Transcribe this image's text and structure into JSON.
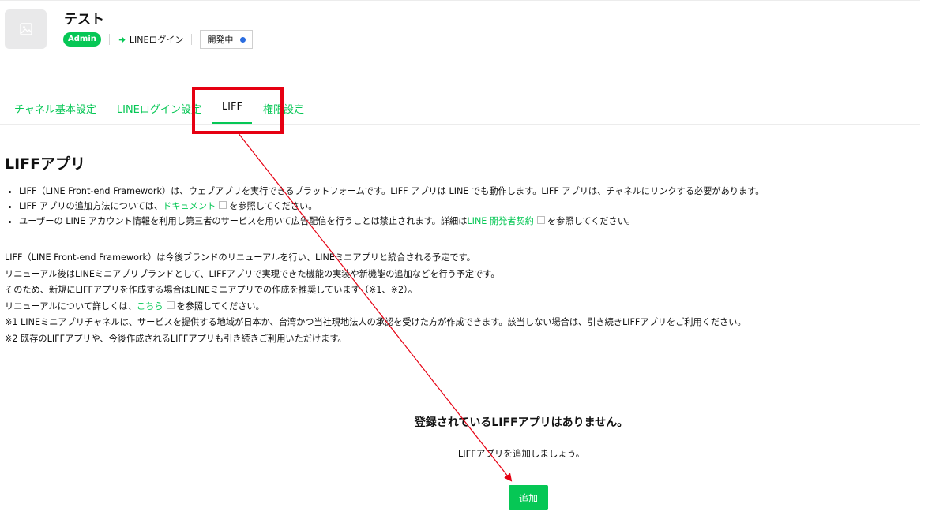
{
  "channel": {
    "name": "テスト",
    "role_badge": "Admin",
    "type_label": "LINEログイン",
    "status_label": "開発中"
  },
  "tabs": [
    {
      "label": "チャネル基本設定"
    },
    {
      "label": "LINEログイン設定"
    },
    {
      "label": "LIFF"
    },
    {
      "label": "権限設定"
    }
  ],
  "section": {
    "title": "LIFFアプリ",
    "bullet1": "LIFF（LINE Front-end Framework）は、ウェブアプリを実行できるプラットフォームです。LIFF アプリは LINE でも動作します。LIFF アプリは、チャネルにリンクする必要があります。",
    "bullet2_prefix": "LIFF アプリの追加方法については、",
    "bullet2_link": "ドキュメント",
    "bullet2_suffix": "を参照してください。",
    "bullet3_prefix": "ユーザーの LINE アカウント情報を利用し第三者のサービスを用いて広告配信を行うことは禁止されます。詳細は",
    "bullet3_link": "LINE 開発者契約",
    "bullet3_suffix": "を参照してください。"
  },
  "notice": {
    "line1": "LIFF（LINE Front-end Framework）は今後ブランドのリニューアルを行い、LINEミニアプリと統合される予定です。",
    "line2": "リニューアル後はLINEミニアプリブランドとして、LIFFアプリで実現できた機能の実装や新機能の追加などを行う予定です。",
    "line3": "そのため、新規にLIFFアプリを作成する場合はLINEミニアプリでの作成を推奨しています（※1、※2）。",
    "line4_prefix": "リニューアルについて詳しくは、",
    "line4_link": "こちら",
    "line4_suffix": "を参照してください。",
    "note1": "※1 LINEミニアプリチャネルは、サービスを提供する地域が日本か、台湾かつ当社現地法人の承認を受けた方が作成できます。該当しない場合は、引き続きLIFFアプリをご利用ください。",
    "note2": "※2 既存のLIFFアプリや、今後作成されるLIFFアプリも引き続きご利用いただけます。"
  },
  "empty_state": {
    "title": "登録されているLIFFアプリはありません。",
    "subtitle": "LIFFアプリを追加しましょう。",
    "button_label": "追加"
  },
  "colors": {
    "accent": "#06c755",
    "annotation": "#e60012",
    "status_dot": "#2b6de0"
  }
}
